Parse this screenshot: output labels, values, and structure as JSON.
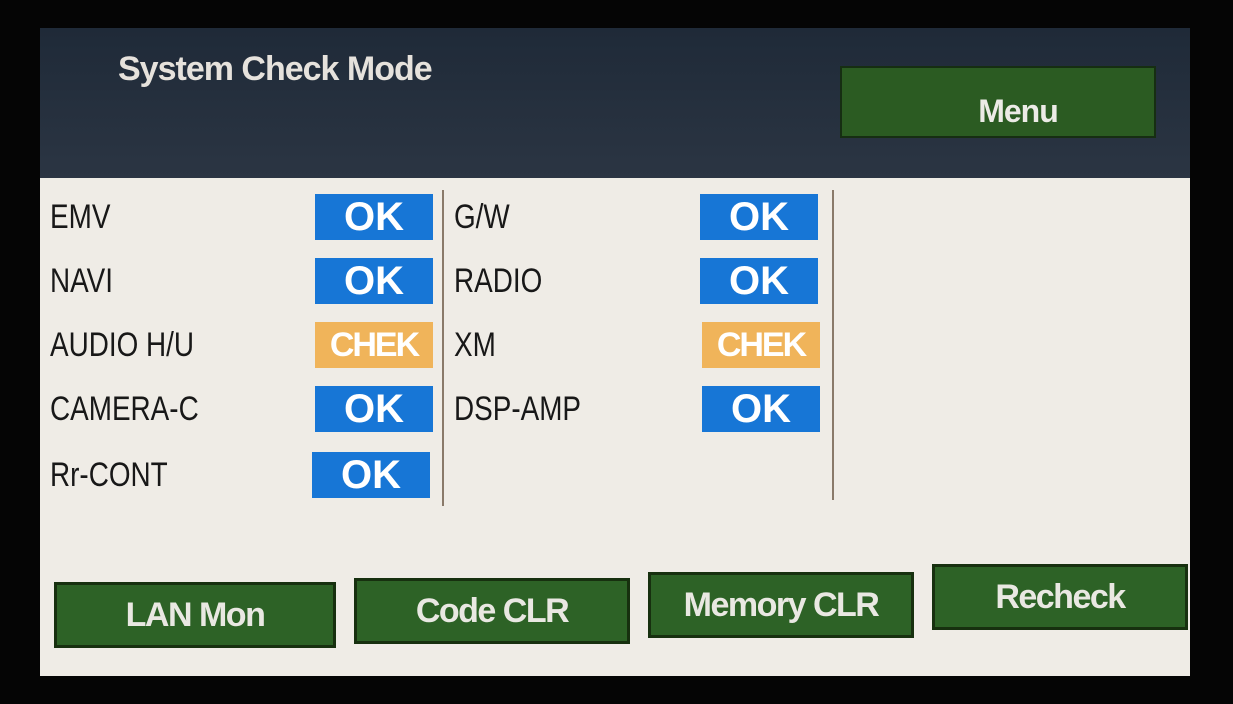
{
  "header": {
    "title": "System Check Mode",
    "menu_label": "Menu"
  },
  "left_column": [
    {
      "label": "EMV",
      "status": "OK"
    },
    {
      "label": "NAVI",
      "status": "OK"
    },
    {
      "label": "AUDIO H/U",
      "status": "CHEK"
    },
    {
      "label": "CAMERA-C",
      "status": "OK"
    },
    {
      "label": "Rr-CONT",
      "status": "OK"
    }
  ],
  "right_column": [
    {
      "label": "G/W",
      "status": "OK"
    },
    {
      "label": "RADIO",
      "status": "OK"
    },
    {
      "label": "XM",
      "status": "CHEK"
    },
    {
      "label": "DSP-AMP",
      "status": "OK"
    }
  ],
  "footer": {
    "lan_mon": "LAN Mon",
    "code_clr": "Code CLR",
    "memory_clr": "Memory CLR",
    "recheck": "Recheck"
  },
  "colors": {
    "ok": "#1776d6",
    "check": "#f0b45a",
    "button_green": "#2d6226",
    "header_bg": "#1f2a38"
  }
}
